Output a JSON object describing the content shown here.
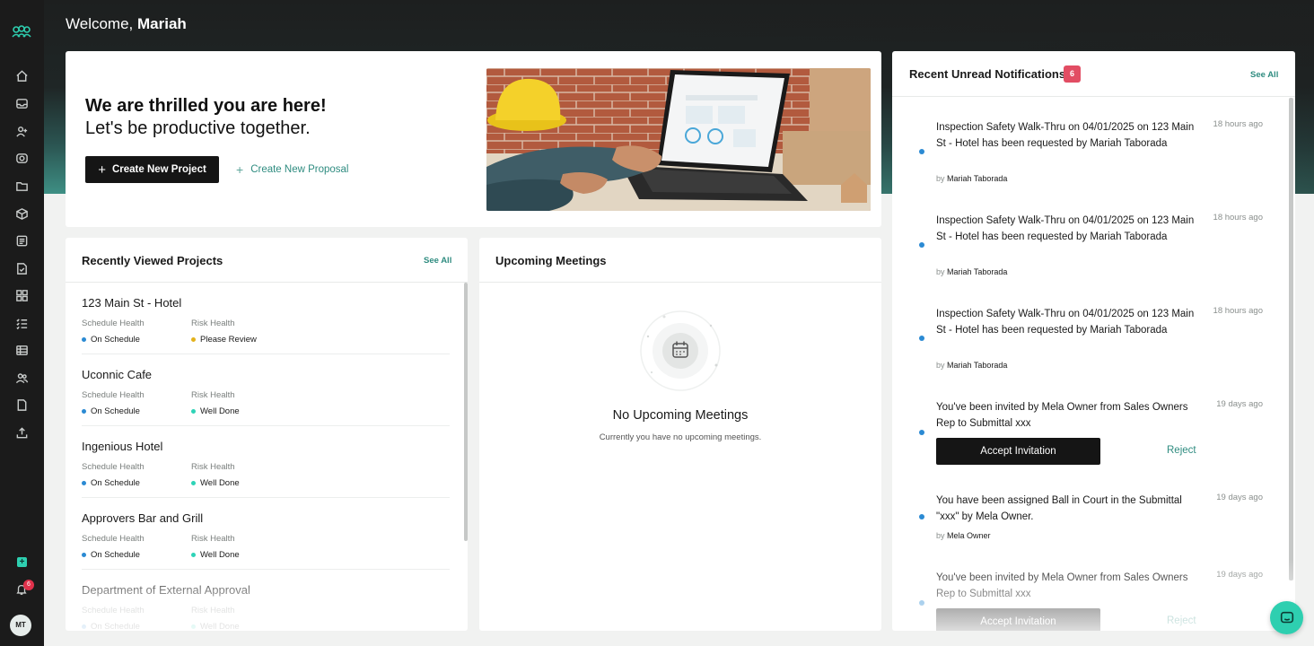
{
  "user": {
    "welcome_prefix": "Welcome,",
    "name": "Mariah",
    "initials": "MT",
    "notification_badge": "6"
  },
  "hero": {
    "headline": "We are thrilled you are here!",
    "subline": "Let's be productive together.",
    "create_project_label": "Create New Project",
    "create_proposal_label": "Create New Proposal",
    "illustration": "worker-with-hardhat-at-laptop"
  },
  "projects": {
    "title": "Recently Viewed Projects",
    "see_all_label": "See All",
    "schedule_label": "Schedule Health",
    "risk_label": "Risk Health",
    "items": [
      {
        "name": "123 Main St - Hotel",
        "schedule": "On Schedule",
        "schedule_color": "#2b8ad3",
        "risk": "Please Review",
        "risk_color": "#e3b21c"
      },
      {
        "name": "Uconnic Cafe",
        "schedule": "On Schedule",
        "schedule_color": "#2b8ad3",
        "risk": "Well Done",
        "risk_color": "#2ed3b7"
      },
      {
        "name": "Ingenious Hotel",
        "schedule": "On Schedule",
        "schedule_color": "#2b8ad3",
        "risk": "Well Done",
        "risk_color": "#2ed3b7"
      },
      {
        "name": "Approvers Bar and Grill",
        "schedule": "On Schedule",
        "schedule_color": "#2b8ad3",
        "risk": "Well Done",
        "risk_color": "#2ed3b7"
      },
      {
        "name": "Department of External Approval",
        "schedule": "On Schedule",
        "schedule_color": "#2b8ad3",
        "risk": "Well Done",
        "risk_color": "#2ed3b7"
      }
    ]
  },
  "meetings": {
    "title": "Upcoming Meetings",
    "empty_title": "No Upcoming Meetings",
    "empty_subtitle": "Currently you have no upcoming meetings."
  },
  "notifications": {
    "title": "Recent Unread Notifications",
    "count": "6",
    "see_all_label": "See All",
    "by_prefix": "by",
    "accept_label": "Accept Invitation",
    "reject_label": "Reject",
    "items": [
      {
        "text": "Inspection Safety Walk-Thru on 04/01/2025 on 123 Main St - Hotel has been requested by Mariah Taborada",
        "time": "18 hours ago",
        "by": "Mariah Taborada"
      },
      {
        "text": "Inspection Safety Walk-Thru on 04/01/2025 on 123 Main St - Hotel has been requested by Mariah Taborada",
        "time": "18 hours ago",
        "by": "Mariah Taborada"
      },
      {
        "text": "Inspection Safety Walk-Thru on 04/01/2025 on 123 Main St - Hotel has been requested by Mariah Taborada",
        "time": "18 hours ago",
        "by": "Mariah Taborada"
      },
      {
        "text": "You've been invited by Mela Owner from Sales Owners Rep to Submittal xxx",
        "time": "19 days ago"
      },
      {
        "text": "You have been assigned Ball in Court in the Submittal \"xxx\" by Mela Owner.",
        "time": "19 days ago",
        "by": "Mela Owner"
      },
      {
        "text": "You've been invited by Mela Owner from Sales Owners Rep to Submittal xxx",
        "time": "19 days ago"
      }
    ]
  },
  "sidebar": {
    "icons": [
      "home-icon",
      "inbox-icon",
      "user-plus-icon",
      "camera-icon",
      "folder-icon",
      "box-icon",
      "list-doc-icon",
      "document-check-icon",
      "grid-icon",
      "checklist-icon",
      "table-icon",
      "users-icon",
      "file-icon",
      "upload-icon"
    ]
  }
}
